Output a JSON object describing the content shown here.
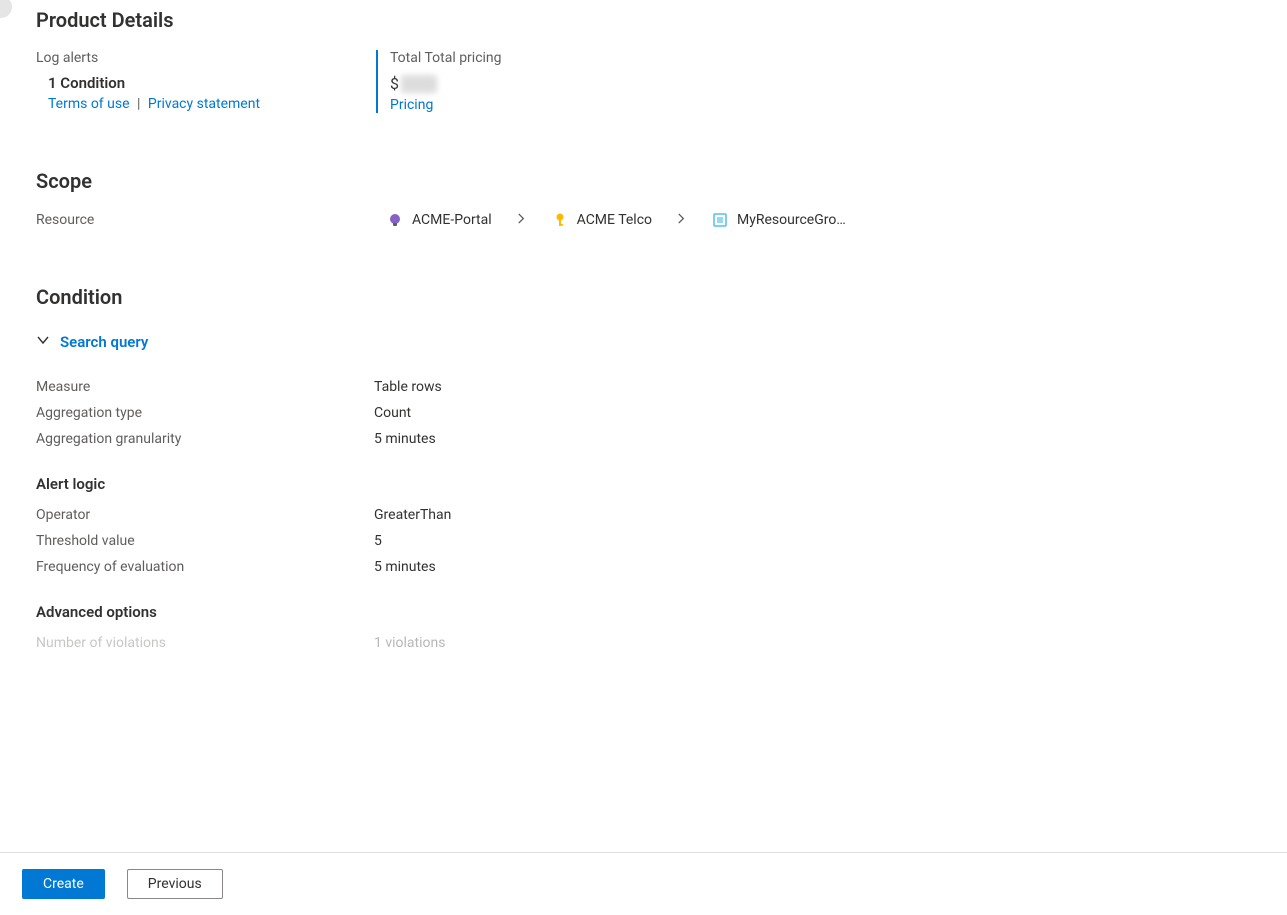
{
  "productDetails": {
    "title": "Product Details",
    "leftLabel": "Log alerts",
    "conditionLine": "1 Condition",
    "termsLink": "Terms of use",
    "privacyLink": "Privacy statement",
    "rightLabel": "Total Total pricing",
    "currency": "$",
    "pricingLink": "Pricing"
  },
  "scope": {
    "title": "Scope",
    "label": "Resource",
    "breadcrumb": [
      {
        "text": "ACME-Portal",
        "iconColor": "#8661c5"
      },
      {
        "text": "ACME Telco",
        "iconColor": "#ffb900"
      },
      {
        "text": "MyResourceGro…",
        "iconColor": "#50c0e8"
      }
    ]
  },
  "condition": {
    "title": "Condition",
    "searchQuery": "Search query",
    "rows": [
      {
        "label": "Measure",
        "value": "Table rows"
      },
      {
        "label": "Aggregation type",
        "value": "Count"
      },
      {
        "label": "Aggregation granularity",
        "value": "5 minutes"
      }
    ],
    "alertLogic": {
      "title": "Alert logic",
      "rows": [
        {
          "label": "Operator",
          "value": "GreaterThan"
        },
        {
          "label": "Threshold value",
          "value": "5"
        },
        {
          "label": "Frequency of evaluation",
          "value": "5 minutes"
        }
      ]
    },
    "advancedOptions": {
      "title": "Advanced options",
      "rows": [
        {
          "label": "Number of violations",
          "value": "1 violations"
        }
      ]
    }
  },
  "footer": {
    "create": "Create",
    "previous": "Previous"
  }
}
